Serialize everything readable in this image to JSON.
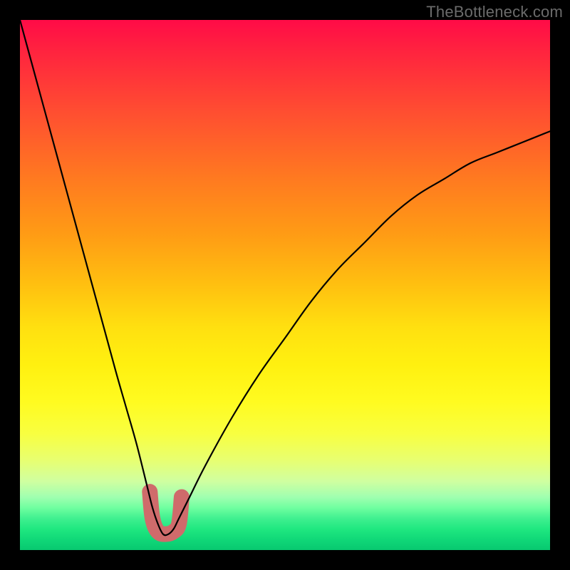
{
  "watermark": "TheBottleneck.com",
  "colors": {
    "background": "#000000",
    "curve": "#000000",
    "blob": "#cf6b6b",
    "gradient_top": "#ff0b47",
    "gradient_bottom": "#08c870"
  },
  "chart_data": {
    "type": "line",
    "title": "",
    "xlabel": "",
    "ylabel": "",
    "xlim": [
      0,
      100
    ],
    "ylim": [
      0,
      100
    ],
    "grid": false,
    "note": "Axis values are unlabeled in the source; x and y are normalized 0–100. y≈100 at top (red), y≈0 at bottom (green). Curve is a V-shape with minimum near x≈27.",
    "series": [
      {
        "name": "bottleneck-curve",
        "x": [
          0,
          3,
          6,
          9,
          12,
          15,
          18,
          20,
          22,
          24,
          25,
          26,
          27,
          28,
          29,
          30,
          32,
          35,
          40,
          45,
          50,
          55,
          60,
          65,
          70,
          75,
          80,
          85,
          90,
          95,
          100
        ],
        "y": [
          100,
          89,
          78,
          67,
          56,
          45,
          34,
          27,
          20,
          12,
          8,
          5,
          3,
          3,
          4,
          6,
          10,
          16,
          25,
          33,
          40,
          47,
          53,
          58,
          63,
          67,
          70,
          73,
          75,
          77,
          79
        ]
      }
    ],
    "highlight": {
      "name": "salmon-blob",
      "description": "Thick salmon stroke near the curve minimum",
      "points_xy": [
        [
          24.5,
          11
        ],
        [
          25,
          6
        ],
        [
          26,
          3.5
        ],
        [
          27.5,
          3
        ],
        [
          29,
          3.5
        ],
        [
          30,
          5
        ],
        [
          30.5,
          10
        ]
      ]
    }
  }
}
